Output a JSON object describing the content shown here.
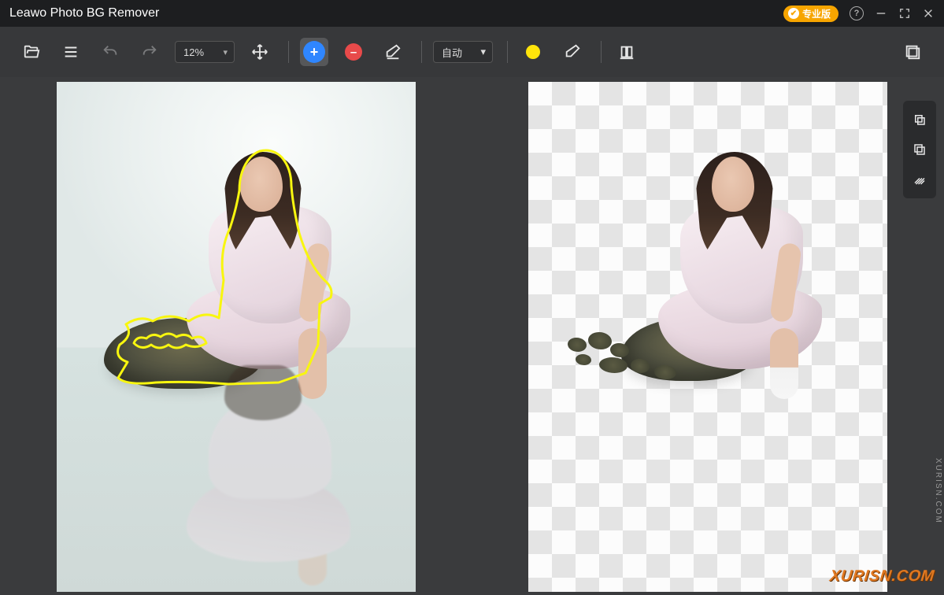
{
  "app": {
    "title": "Leawo Photo BG Remover"
  },
  "titlebar": {
    "pro_badge": "专业版",
    "help_char": "?"
  },
  "toolbar": {
    "zoom_value": "12%",
    "mode_value": "自动",
    "icons": {
      "open": "folder-open-icon",
      "menu": "menu-icon",
      "undo": "undo-icon",
      "redo": "redo-icon",
      "move": "move-icon",
      "mark_keep": "plus-circle-icon",
      "mark_remove": "minus-circle-icon",
      "eraser": "eraser-icon",
      "mode": "mode-select",
      "color": "color-swatch-yellow",
      "erase2": "eraser-outline-icon",
      "crop": "crop-icon",
      "save": "save-layers-icon"
    }
  },
  "side_tools": {
    "items": [
      {
        "name": "copy-icon"
      },
      {
        "name": "duplicate-icon"
      },
      {
        "name": "texture-icon"
      }
    ]
  },
  "watermark": {
    "text": "XURISN.COM",
    "vertical": "XURISN.COM"
  }
}
